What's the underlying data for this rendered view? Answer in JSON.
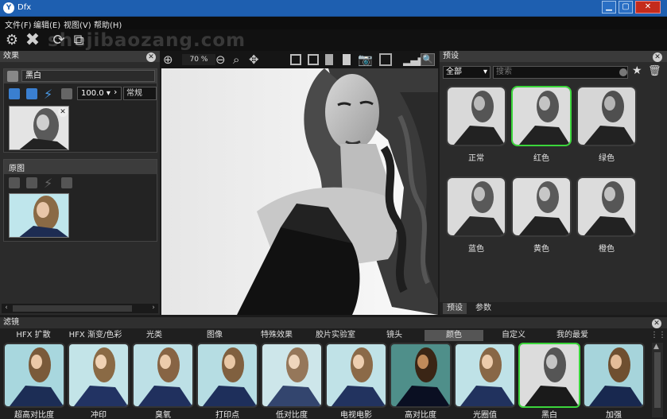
{
  "window": {
    "title": "Dfx",
    "app_icon": "Y"
  },
  "menu": [
    "文件(F)",
    "编辑(E)",
    "视图(V)",
    "帮助(H)"
  ],
  "watermark": "shejibaozang.com",
  "view": {
    "zoom": "70 %"
  },
  "effects_panel": {
    "title": "效果",
    "layer_name": "黑白",
    "opacity": "100.0",
    "blend_mode": "常规",
    "original_title": "原图"
  },
  "presets_panel": {
    "title": "预设",
    "category": "全部",
    "search_placeholder": "搜索",
    "items": [
      "正常",
      "红色",
      "绿色",
      "蓝色",
      "黄色",
      "橙色"
    ],
    "selected": "红色",
    "tabs": [
      "预设",
      "参数"
    ]
  },
  "filters_panel": {
    "title": "滤镜",
    "tabs": [
      "HFX 扩散",
      "HFX 渐变/色彩",
      "光类",
      "图像",
      "特殊效果",
      "胶片实验室",
      "镜头",
      "颜色",
      "自定义",
      "我的最爱"
    ],
    "active_tab": "颜色",
    "items": [
      "超高对比度",
      "冲印",
      "臭氧",
      "打印点",
      "低对比度",
      "电视电影",
      "高对比度",
      "光圈值",
      "黑白",
      "加强"
    ],
    "selected": "黑白"
  },
  "colors": {
    "titlebar": "#1e5fb0",
    "selection": "#3bd63b",
    "panel": "#2b2b2b"
  }
}
